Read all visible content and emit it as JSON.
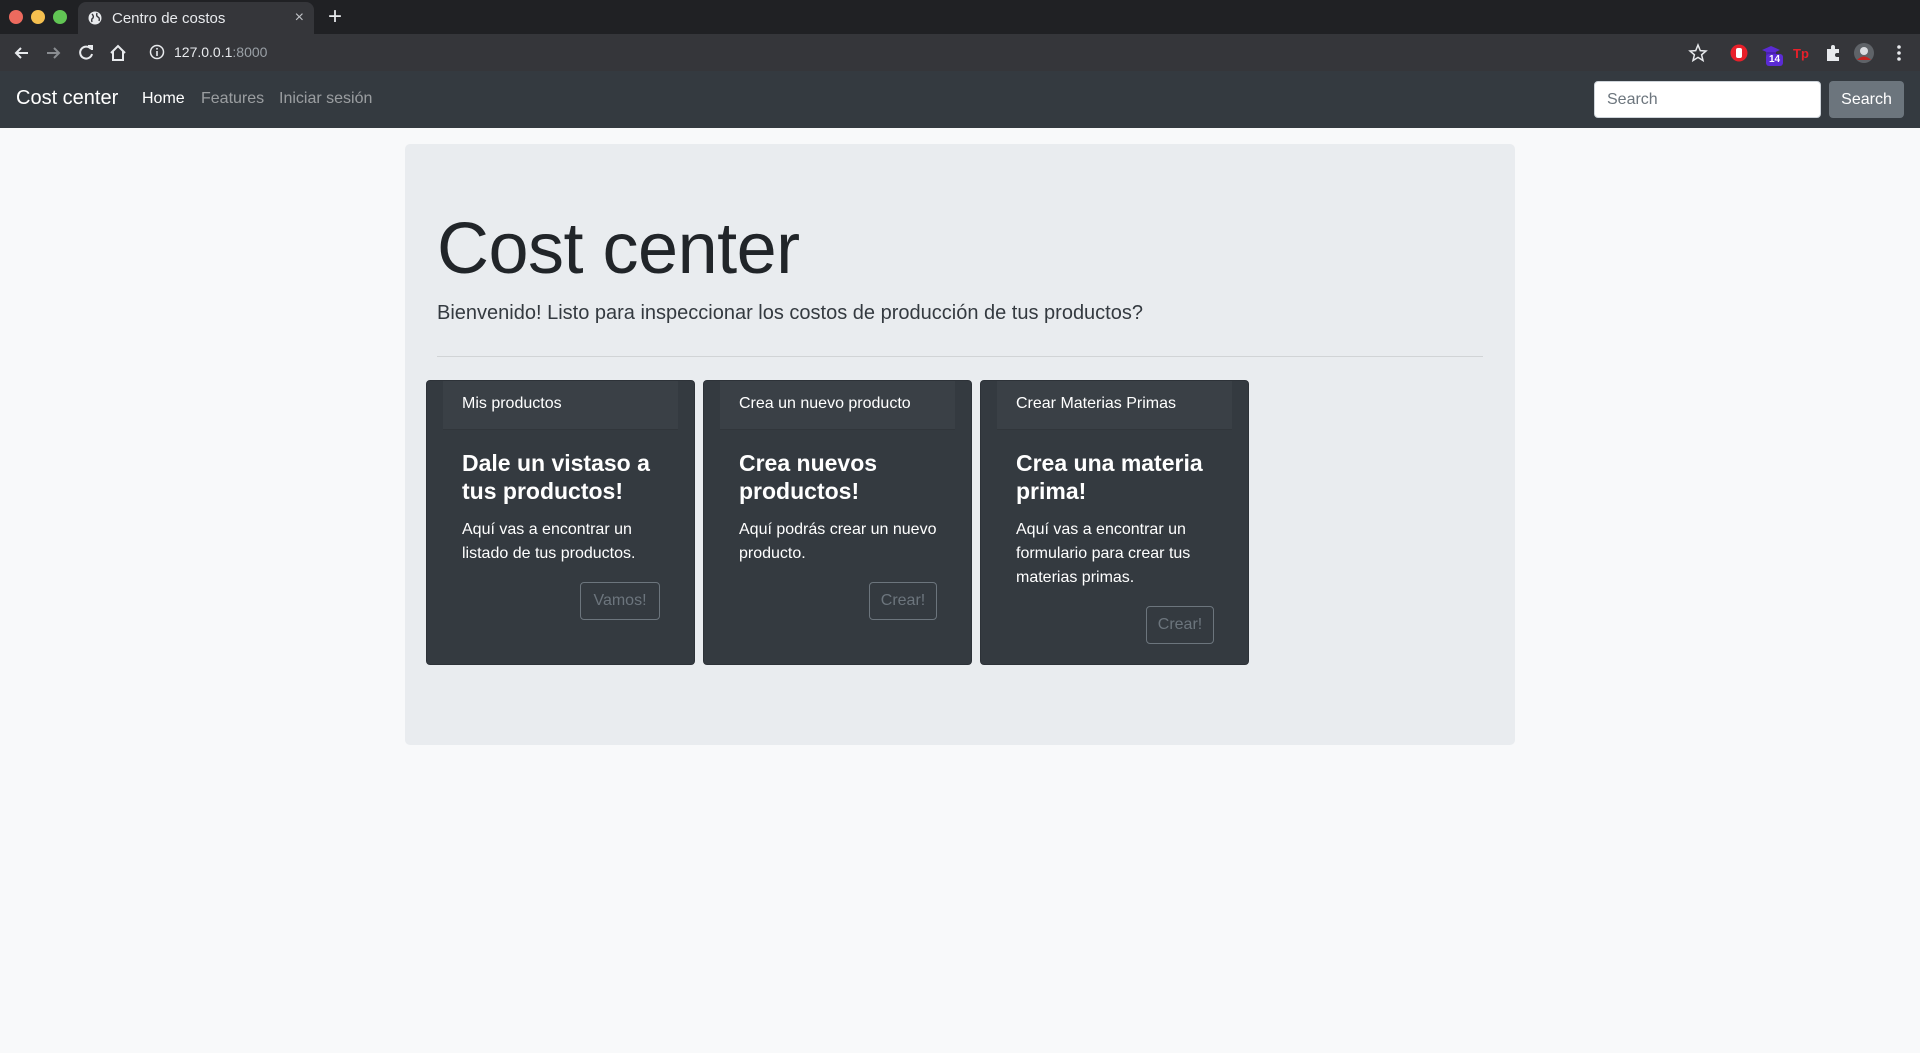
{
  "browser": {
    "tab_title": "Centro de costos",
    "tab_close": "×",
    "new_tab": "+",
    "url_host": "127.0.0.1",
    "url_port": ":8000",
    "extension_badge": "14",
    "icons": [
      "back-icon",
      "forward-icon",
      "reload-icon",
      "home-icon",
      "info-icon",
      "star-icon",
      "extension-puzzle-icon",
      "profile-avatar",
      "menu-dots-icon"
    ]
  },
  "navbar": {
    "brand": "Cost center",
    "links": [
      "Home",
      "Features",
      "Iniciar sesión"
    ],
    "search_placeholder": "Search",
    "search_button": "Search"
  },
  "jumbotron": {
    "title": "Cost center",
    "lead": "Bienvenido! Listo para inspeccionar los costos de producción de tus productos?"
  },
  "cards": [
    {
      "header": "Mis productos",
      "title": "Dale un vistaso a tus productos!",
      "text": "Aquí vas a encontrar un listado de tus productos.",
      "button": "Vamos!"
    },
    {
      "header": "Crea un nuevo producto",
      "title": "Crea nuevos productos!",
      "text": "Aquí podrás crear un nuevo producto.",
      "button": "Crear!"
    },
    {
      "header": "Crear Materias Primas",
      "title": "Crea una materia prima!",
      "text": "Aquí vas a encontrar un formulario para crear tus materias primas.",
      "button": "Crear!"
    }
  ],
  "colors": {
    "navbar_bg": "#343a40",
    "page_bg": "#f8f9fa",
    "jumbotron_bg": "#e9ecef",
    "card_bg": "#343a40",
    "secondary": "#6c757d"
  }
}
